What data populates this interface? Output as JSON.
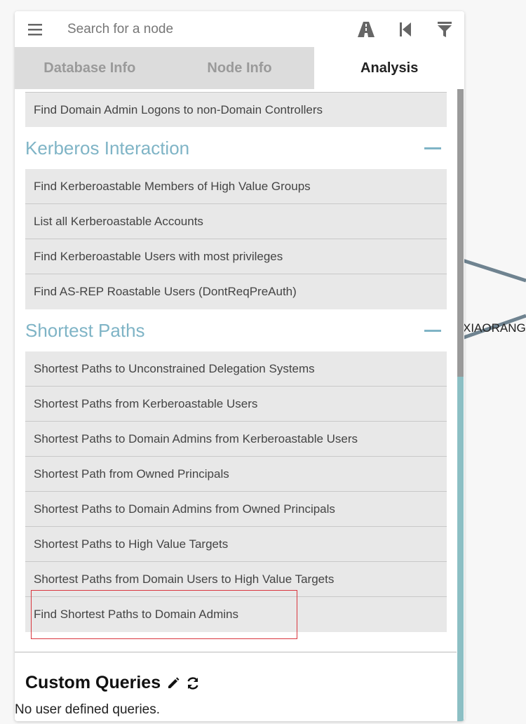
{
  "search": {
    "placeholder": "Search for a node"
  },
  "toolbar": {
    "icons": [
      "pathfinding-icon",
      "back-icon",
      "filter-icon"
    ]
  },
  "tabs": [
    {
      "label": "Database Info",
      "active": false
    },
    {
      "label": "Node Info",
      "active": false
    },
    {
      "label": "Analysis",
      "active": true
    }
  ],
  "analysis": {
    "top_item": "Find Domain Admin Logons to non-Domain Controllers",
    "sections": [
      {
        "title": "Kerberos Interaction",
        "items": [
          "Find Kerberoastable Members of High Value Groups",
          "List all Kerberoastable Accounts",
          "Find Kerberoastable Users with most privileges",
          "Find AS-REP Roastable Users (DontReqPreAuth)"
        ]
      },
      {
        "title": "Shortest Paths",
        "items": [
          "Shortest Paths to Unconstrained Delegation Systems",
          "Shortest Paths from Kerberoastable Users",
          "Shortest Paths to Domain Admins from Kerberoastable Users",
          "Shortest Path from Owned Principals",
          "Shortest Paths to Domain Admins from Owned Principals",
          "Shortest Paths to High Value Targets",
          "Shortest Paths from Domain Users to High Value Targets",
          "Find Shortest Paths to Domain Admins"
        ]
      }
    ]
  },
  "custom_queries": {
    "title": "Custom Queries",
    "empty_text": "No user defined queries."
  },
  "graph": {
    "node_label": "XIAORANG"
  },
  "colors": {
    "accent": "#7fb4c6",
    "highlight": "#d9363e",
    "edge": "#6f8390"
  }
}
